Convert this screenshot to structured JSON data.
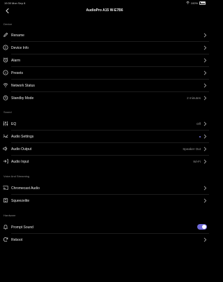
{
  "status_bar": {
    "time": "19:30",
    "date": "Mon Sep 8",
    "battery": "100%"
  },
  "nav": {
    "title": "AudioPro A15 W-E7B6"
  },
  "sections": {
    "device": "Device",
    "sound": "Sound",
    "voice": "Voice And Streaming",
    "hardware": "Hardware"
  },
  "rows": {
    "rename": {
      "label": "Rename"
    },
    "device_info": {
      "label": "Device Info"
    },
    "alarm": {
      "label": "Alarm"
    },
    "presets": {
      "label": "Presets"
    },
    "network_status": {
      "label": "Network Status"
    },
    "standby_mode": {
      "label": "Standby Mode",
      "value": "2 minutes"
    },
    "eq": {
      "label": "EQ",
      "value": "Off"
    },
    "audio_settings": {
      "label": "Audio Settings"
    },
    "audio_output": {
      "label": "Audio Output",
      "value": "Speaker Out"
    },
    "audio_input": {
      "label": "Audio Input",
      "value": "Wi-Fi"
    },
    "chromecast_audio": {
      "label": "Chromecast Audio"
    },
    "squeezelite": {
      "label": "Squeezelite"
    },
    "prompt_sound": {
      "label": "Prompt Sound",
      "enabled": true
    },
    "reboot": {
      "label": "Reboot"
    }
  },
  "colors": {
    "accent": "#6e69d8",
    "background": "#000000",
    "text": "#e9e9e9",
    "secondary": "#9a9a9a"
  }
}
